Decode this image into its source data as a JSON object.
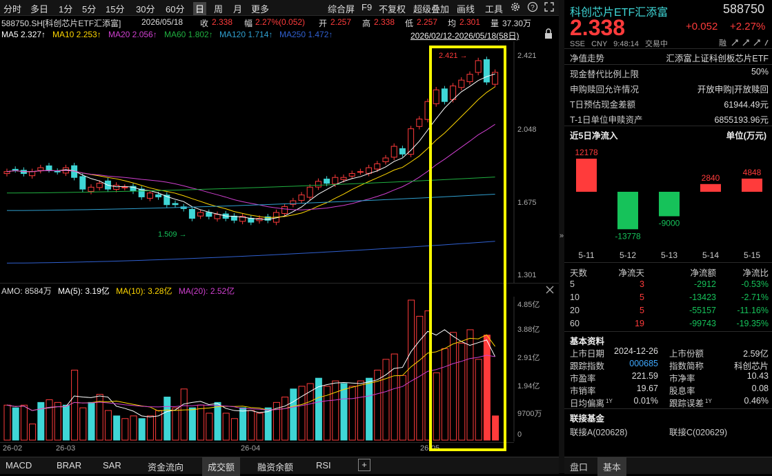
{
  "toolbar": {
    "items": [
      "分时",
      "多日",
      "1分",
      "5分",
      "15分",
      "30分",
      "60分",
      "日",
      "周",
      "月",
      "更多"
    ],
    "selected": "日",
    "right_items": [
      "综合屏",
      "F9",
      "不复权",
      "超级叠加",
      "画线",
      "工具"
    ],
    "settings_icon": "gear-icon",
    "help_icon": "help-icon",
    "fullscreen_icon": "expand-icon"
  },
  "info": {
    "code": "588750.SH[科创芯片ETF汇添富]",
    "date": "2026/05/18",
    "close_label": "收",
    "close": "2.338",
    "change_label": "幅",
    "change": "2.27%(0.052)",
    "open_label": "开",
    "open": "2.257",
    "high_label": "高",
    "high": "2.338",
    "low_label": "低",
    "low": "2.257",
    "avg_label": "均",
    "avg": "2.301",
    "vol_label": "量",
    "vol": "37.30万"
  },
  "ma_line": {
    "ma5": "MA5 2.327↑",
    "ma10": "MA10 2.253↑",
    "ma20": "MA20 2.056↑",
    "ma60": "MA60 1.802↑",
    "ma120": "MA120 1.714↑",
    "ma250": "MA250 1.472↑",
    "range": "2026/02/12-2026/05/18(58日)"
  },
  "colors": {
    "up": "#ff3b3b",
    "down": "#3fd6d6",
    "ma5": "#ffffff",
    "ma10": "#ffd700",
    "ma20": "#d040d0",
    "ma60": "#20b040",
    "ma120": "#30a0d0",
    "ma250": "#3060d0",
    "highlight": "#ffff00"
  },
  "price_axis": [
    "2.421",
    "2.048",
    "1.675",
    "1.301"
  ],
  "price_annotations": {
    "high": "2.421",
    "low": "1.509"
  },
  "amo": {
    "label": "AMO: 8584万",
    "ma5": "MA(5): 3.19亿",
    "ma10": "MA(10): 3.28亿",
    "ma20": "MA(20): 2.52亿"
  },
  "vol_axis": [
    "4.85亿",
    "3.88亿",
    "2.91亿",
    "1.94亿",
    "9700万",
    "0"
  ],
  "dates": [
    "26-02",
    "26-03",
    "26-04",
    "26-05"
  ],
  "bottom_tabs": [
    "MACD",
    "BRAR",
    "SAR",
    "资金流向",
    "成交额",
    "融资余额",
    "RSI"
  ],
  "bottom_selected": "成交额",
  "bottom_plus": "+",
  "right": {
    "name": "科创芯片ETF汇添富",
    "code": "588750",
    "price": "2.338",
    "change": "+0.052",
    "pct": "+2.27%",
    "market": "SSE",
    "currency": "CNY",
    "time": "9:48:14",
    "status": "交易中",
    "nav_label": "净值走势",
    "nav_value": "汇添富上证科创板芯片ETF",
    "rows": [
      {
        "l": "现金替代比例上限",
        "r": "50%"
      },
      {
        "l": "申购赎回允许情况",
        "r": "开放申购|开放赎回"
      },
      {
        "l": "T日预估现金差额",
        "r": "61944.49元"
      },
      {
        "l": "T-1日单位申赎资产",
        "r": "6855193.96元"
      }
    ],
    "flow_title": "近5日净流入",
    "flow_unit": "单位(万元)",
    "flow_chart": {
      "type": "bar",
      "categories": [
        "5-11",
        "5-12",
        "5-13",
        "5-14",
        "5-15"
      ],
      "values": [
        12178,
        -13778,
        -9000,
        2840,
        4848
      ]
    },
    "table_headers": [
      "天数",
      "净流天",
      "净流额",
      "净流比"
    ],
    "table_rows": [
      [
        "5",
        "3",
        "-2912",
        "-0.53%"
      ],
      [
        "10",
        "5",
        "-13423",
        "-2.71%"
      ],
      [
        "20",
        "5",
        "-55157",
        "-11.16%"
      ],
      [
        "60",
        "19",
        "-99743",
        "-19.35%"
      ]
    ],
    "basic_title": "基本资料",
    "basic": [
      [
        "上市日期",
        "2024-12-26",
        "上市份额",
        "2.59亿"
      ],
      [
        "跟踪指数",
        "000685",
        "指数简称",
        "科创芯片"
      ],
      [
        "市盈率",
        "221.59",
        "市净率",
        "10.43"
      ],
      [
        "市销率",
        "19.67",
        "股息率",
        "0.08"
      ],
      [
        "日均偏离",
        "0.01%",
        "跟踪误差",
        "0.46%"
      ]
    ],
    "link_title": "联接基金",
    "links": [
      "联接A(020628)",
      "联接C(020629)"
    ],
    "tabs": [
      "盘口",
      "基本"
    ],
    "tab_selected": "基本",
    "hui": "融",
    "sup_1y": "1Y",
    "cap_3": "3"
  },
  "chart_data": [
    {
      "type": "candlestick",
      "title": "588750.SH 科创芯片ETF汇添富 日K",
      "y_axis_ticks": [
        2.421,
        2.048,
        1.675,
        1.301
      ],
      "ylim": [
        1.301,
        2.421
      ],
      "x_ticks": [
        "26-02",
        "26-03",
        "26-04",
        "26-05"
      ],
      "last_close": 2.338,
      "period_high": 2.421,
      "period_low": 1.509,
      "ma": {
        "MA5": 2.327,
        "MA10": 2.253,
        "MA20": 2.056,
        "MA60": 1.802,
        "MA120": 1.714,
        "MA250": 1.472
      }
    },
    {
      "type": "bar",
      "title": "AMO",
      "y_axis_ticks": [
        "4.85亿",
        "3.88亿",
        "2.91亿",
        "1.94亿",
        "9700万",
        "0"
      ],
      "ma": {
        "MA(5)": "3.19亿",
        "MA(10)": "3.28亿",
        "MA(20)": "2.52亿"
      },
      "last": "8584万"
    },
    {
      "type": "bar",
      "title": "近5日净流入",
      "categories": [
        "5-11",
        "5-12",
        "5-13",
        "5-14",
        "5-15"
      ],
      "values": [
        12178,
        -13778,
        -9000,
        2840,
        4848
      ],
      "ylabel": "单位(万元)"
    }
  ]
}
